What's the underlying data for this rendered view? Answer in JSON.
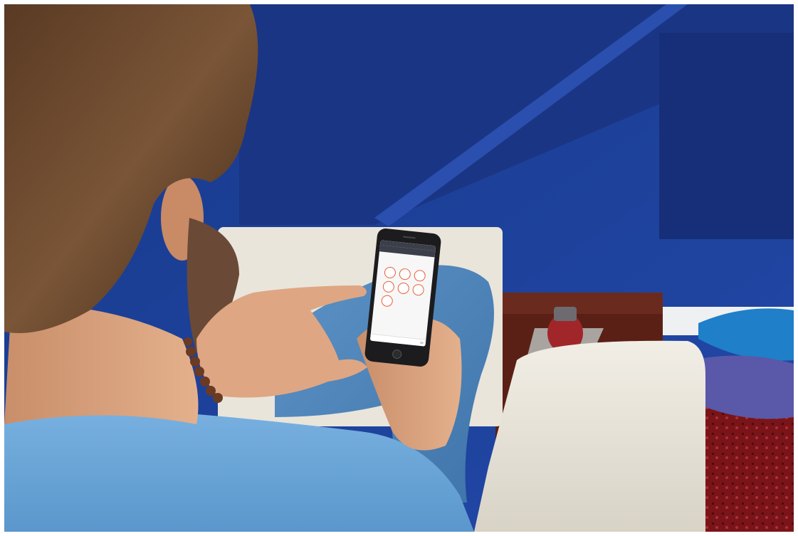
{
  "phone": {
    "status": {
      "carrier": "",
      "time": "",
      "battery": ""
    },
    "nav_title": "",
    "heading": "",
    "circles": [
      {
        "label": ""
      },
      {
        "label": ""
      },
      {
        "label": ""
      },
      {
        "label": ""
      },
      {
        "label": ""
      },
      {
        "label": ""
      },
      {
        "label": ""
      }
    ],
    "footer_label": ""
  },
  "colors": {
    "wall": "#1e3f95",
    "shirt": "#6aa6d8",
    "sofa": "#e9e5db",
    "accent_circles": "#e8613a",
    "cushion": "#1f7fc9"
  }
}
